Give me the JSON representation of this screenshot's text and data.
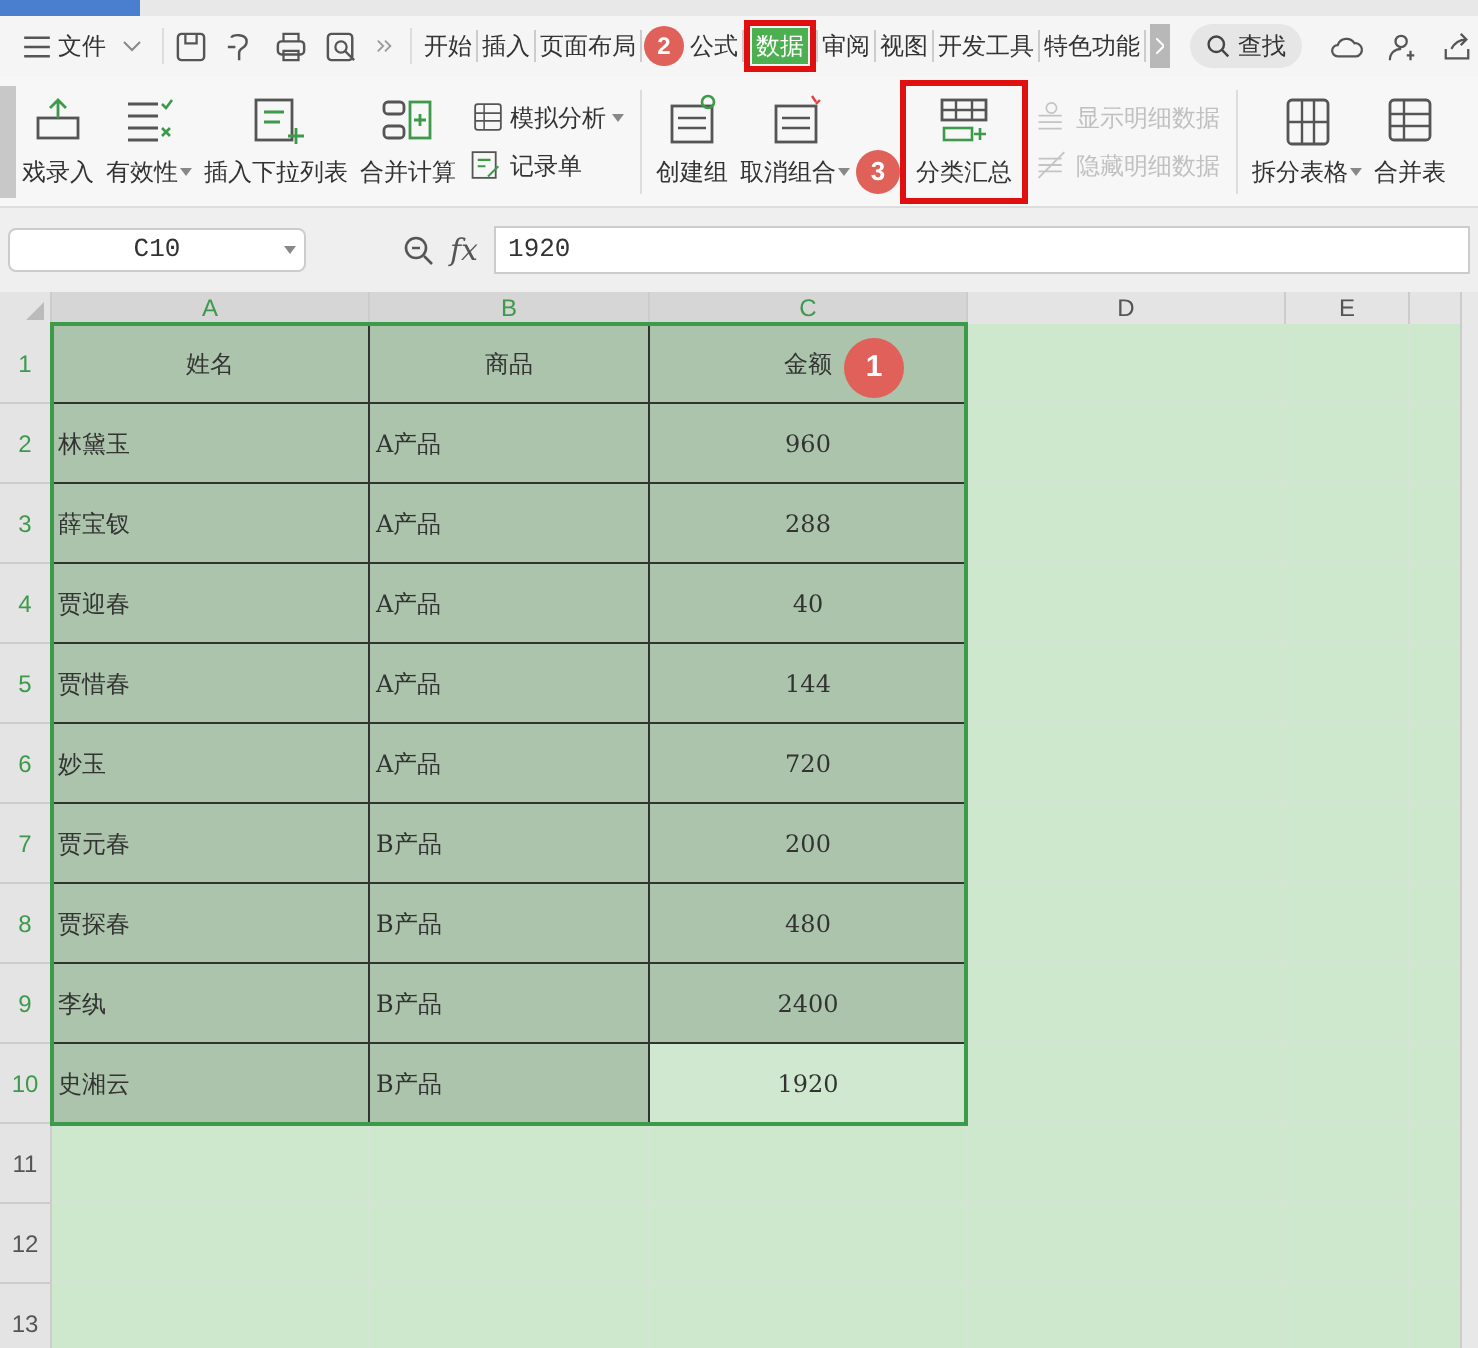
{
  "menu": {
    "file": "文件",
    "tabs": [
      {
        "label": "开始",
        "selected": false,
        "highlighted": false
      },
      {
        "label": "插入",
        "selected": false,
        "highlighted": false
      },
      {
        "label": "页面布局",
        "selected": false,
        "highlighted": false
      },
      {
        "label": "公式",
        "selected": false,
        "highlighted": false
      },
      {
        "label": "数据",
        "selected": true,
        "highlighted": true
      },
      {
        "label": "审阅",
        "selected": false,
        "highlighted": false
      },
      {
        "label": "视图",
        "selected": false,
        "highlighted": false
      },
      {
        "label": "开发工具",
        "selected": false,
        "highlighted": false
      },
      {
        "label": "特色功能",
        "selected": false,
        "highlighted": false
      }
    ],
    "search": "查找"
  },
  "ribbon": [
    {
      "kind": "big",
      "label": "戏录入",
      "dropdown": false,
      "disabled": false,
      "highlighted": false
    },
    {
      "kind": "big",
      "label": "有效性",
      "dropdown": true,
      "disabled": false,
      "highlighted": false
    },
    {
      "kind": "big",
      "label": "插入下拉列表",
      "dropdown": false,
      "disabled": false,
      "highlighted": false
    },
    {
      "kind": "big",
      "label": "合并计算",
      "dropdown": false,
      "disabled": false,
      "highlighted": false
    },
    {
      "kind": "stack",
      "items": [
        {
          "label": "模拟分析",
          "dropdown": true,
          "disabled": false
        },
        {
          "label": "记录单",
          "dropdown": false,
          "disabled": false
        }
      ]
    },
    {
      "kind": "divider"
    },
    {
      "kind": "big",
      "label": "创建组",
      "dropdown": false,
      "disabled": false,
      "highlighted": false
    },
    {
      "kind": "big",
      "label": "取消组合",
      "dropdown": true,
      "disabled": false,
      "highlighted": false
    },
    {
      "kind": "big",
      "label": "分类汇总",
      "dropdown": false,
      "disabled": false,
      "highlighted": true
    },
    {
      "kind": "stack",
      "items": [
        {
          "label": "显示明细数据",
          "dropdown": false,
          "disabled": true
        },
        {
          "label": "隐藏明细数据",
          "dropdown": false,
          "disabled": true
        }
      ]
    },
    {
      "kind": "divider"
    },
    {
      "kind": "big",
      "label": "拆分表格",
      "dropdown": true,
      "disabled": false,
      "highlighted": false
    },
    {
      "kind": "big",
      "label": "合并表",
      "dropdown": false,
      "disabled": false,
      "highlighted": false
    }
  ],
  "name_box": "C10",
  "function_label": "fx",
  "formula": "1920",
  "columns": [
    {
      "label": "A",
      "selected": true
    },
    {
      "label": "B",
      "selected": true
    },
    {
      "label": "C",
      "selected": true
    },
    {
      "label": "D",
      "selected": false
    },
    {
      "label": "E",
      "selected": false
    }
  ],
  "rows": [
    {
      "number": "1",
      "kind": "header",
      "cells": [
        {
          "text": "姓名",
          "selected": false
        },
        {
          "text": "商品",
          "selected": false
        },
        {
          "text": "金额",
          "selected": false
        }
      ]
    },
    {
      "number": "2",
      "kind": "data",
      "cells": [
        {
          "text": "林黛玉",
          "selected": false
        },
        {
          "text": "A产品",
          "selected": false
        },
        {
          "text": "960",
          "selected": false
        }
      ]
    },
    {
      "number": "3",
      "kind": "data",
      "cells": [
        {
          "text": "薛宝钗",
          "selected": false
        },
        {
          "text": "A产品",
          "selected": false
        },
        {
          "text": "288",
          "selected": false
        }
      ]
    },
    {
      "number": "4",
      "kind": "data",
      "cells": [
        {
          "text": "贾迎春",
          "selected": false
        },
        {
          "text": "A产品",
          "selected": false
        },
        {
          "text": "40",
          "selected": false
        }
      ]
    },
    {
      "number": "5",
      "kind": "data",
      "cells": [
        {
          "text": "贾惜春",
          "selected": false
        },
        {
          "text": "A产品",
          "selected": false
        },
        {
          "text": "144",
          "selected": false
        }
      ]
    },
    {
      "number": "6",
      "kind": "data",
      "cells": [
        {
          "text": "妙玉",
          "selected": false
        },
        {
          "text": "A产品",
          "selected": false
        },
        {
          "text": "720",
          "selected": false
        }
      ]
    },
    {
      "number": "7",
      "kind": "data",
      "cells": [
        {
          "text": "贾元春",
          "selected": false
        },
        {
          "text": "B产品",
          "selected": false
        },
        {
          "text": "200",
          "selected": false
        }
      ]
    },
    {
      "number": "8",
      "kind": "data",
      "cells": [
        {
          "text": "贾探春",
          "selected": false
        },
        {
          "text": "B产品",
          "selected": false
        },
        {
          "text": "480",
          "selected": false
        }
      ]
    },
    {
      "number": "9",
      "kind": "data",
      "cells": [
        {
          "text": "李纨",
          "selected": false
        },
        {
          "text": "B产品",
          "selected": false
        },
        {
          "text": "2400",
          "selected": false
        }
      ]
    },
    {
      "number": "10",
      "kind": "data",
      "cells": [
        {
          "text": "史湘云",
          "selected": false
        },
        {
          "text": "B产品",
          "selected": false
        },
        {
          "text": "1920",
          "selected": true
        }
      ]
    },
    {
      "number": "11",
      "kind": "empty",
      "cells": []
    },
    {
      "number": "12",
      "kind": "empty",
      "cells": []
    },
    {
      "number": "13",
      "kind": "empty",
      "cells": []
    }
  ],
  "annotations": [
    "1",
    "2",
    "3"
  ]
}
